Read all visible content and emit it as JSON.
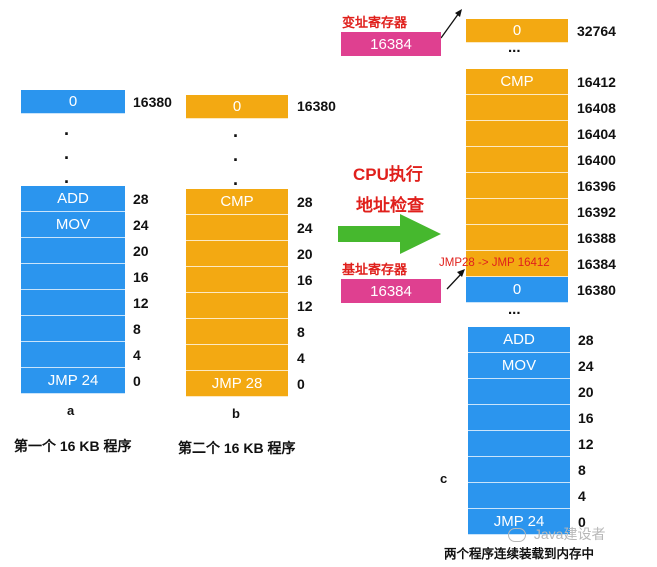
{
  "program_a": {
    "top_cell": "0",
    "top_addr": "16380",
    "cells": [
      "ADD",
      "MOV",
      "",
      "",
      "",
      "",
      "",
      "JMP 24"
    ],
    "addrs": [
      "28",
      "24",
      "20",
      "16",
      "12",
      "8",
      "4",
      "0"
    ],
    "label": "a",
    "caption": "第一个 16 KB 程序",
    "colors": {
      "cell": "#2b95ee"
    }
  },
  "program_b": {
    "top_cell": "0",
    "top_addr": "16380",
    "cells": [
      "CMP",
      "",
      "",
      "",
      "",
      "",
      "",
      "JMP 28"
    ],
    "addrs": [
      "28",
      "24",
      "20",
      "16",
      "12",
      "8",
      "4",
      "0"
    ],
    "label": "b",
    "caption": "第二个 16 KB 程序",
    "colors": {
      "cell": "#f3a912"
    }
  },
  "cpu": {
    "line1": "CPU执行",
    "line2": "地址检查",
    "arrow_color": "#46b82e"
  },
  "limit_register": {
    "label": "变址寄存器",
    "value": "16384",
    "color": "#df4090"
  },
  "base_register": {
    "label": "基址寄存器",
    "value": "16384",
    "color": "#df4090"
  },
  "memory_c": {
    "top_cell": "0",
    "top_addr": "32764",
    "ellipsis": "...",
    "upper_cells": [
      "CMP",
      "",
      "",
      "",
      "",
      "",
      "",
      "",
      "0"
    ],
    "upper_addrs": [
      "16412",
      "16408",
      "16404",
      "16400",
      "16396",
      "16392",
      "16388",
      "16384",
      "16380"
    ],
    "jmp_note": "JMP28 -> JMP 16412",
    "mid_ellipsis": "...",
    "lower_cells": [
      "ADD",
      "MOV",
      "",
      "",
      "",
      "",
      "",
      "JMP 24"
    ],
    "lower_addrs": [
      "28",
      "24",
      "20",
      "16",
      "12",
      "8",
      "4",
      "0"
    ],
    "label": "c",
    "caption": "两个程序连续装载到内存中"
  },
  "watermark": "Java建设者"
}
